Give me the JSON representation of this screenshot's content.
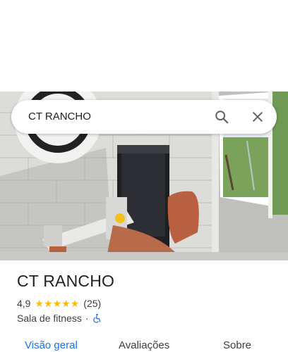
{
  "search": {
    "query": "CT RANCHO",
    "search_icon": "search-icon",
    "close_icon": "close-icon"
  },
  "photo": {
    "alt": "gym-equipment-photo"
  },
  "place": {
    "name": "CT RANCHO",
    "rating": "4,9",
    "stars": 5,
    "review_count": "(25)",
    "category": "Sala de fitness",
    "separator": "·",
    "accessibility_icon": "wheelchair-icon"
  },
  "tabs": [
    {
      "label": "Visão geral",
      "active": true
    },
    {
      "label": "Avaliações",
      "active": false
    },
    {
      "label": "Sobre",
      "active": false
    }
  ],
  "colors": {
    "accent": "#1a73e8",
    "star": "#fbbc04",
    "text": "#202124",
    "secondary": "#3c4043"
  }
}
